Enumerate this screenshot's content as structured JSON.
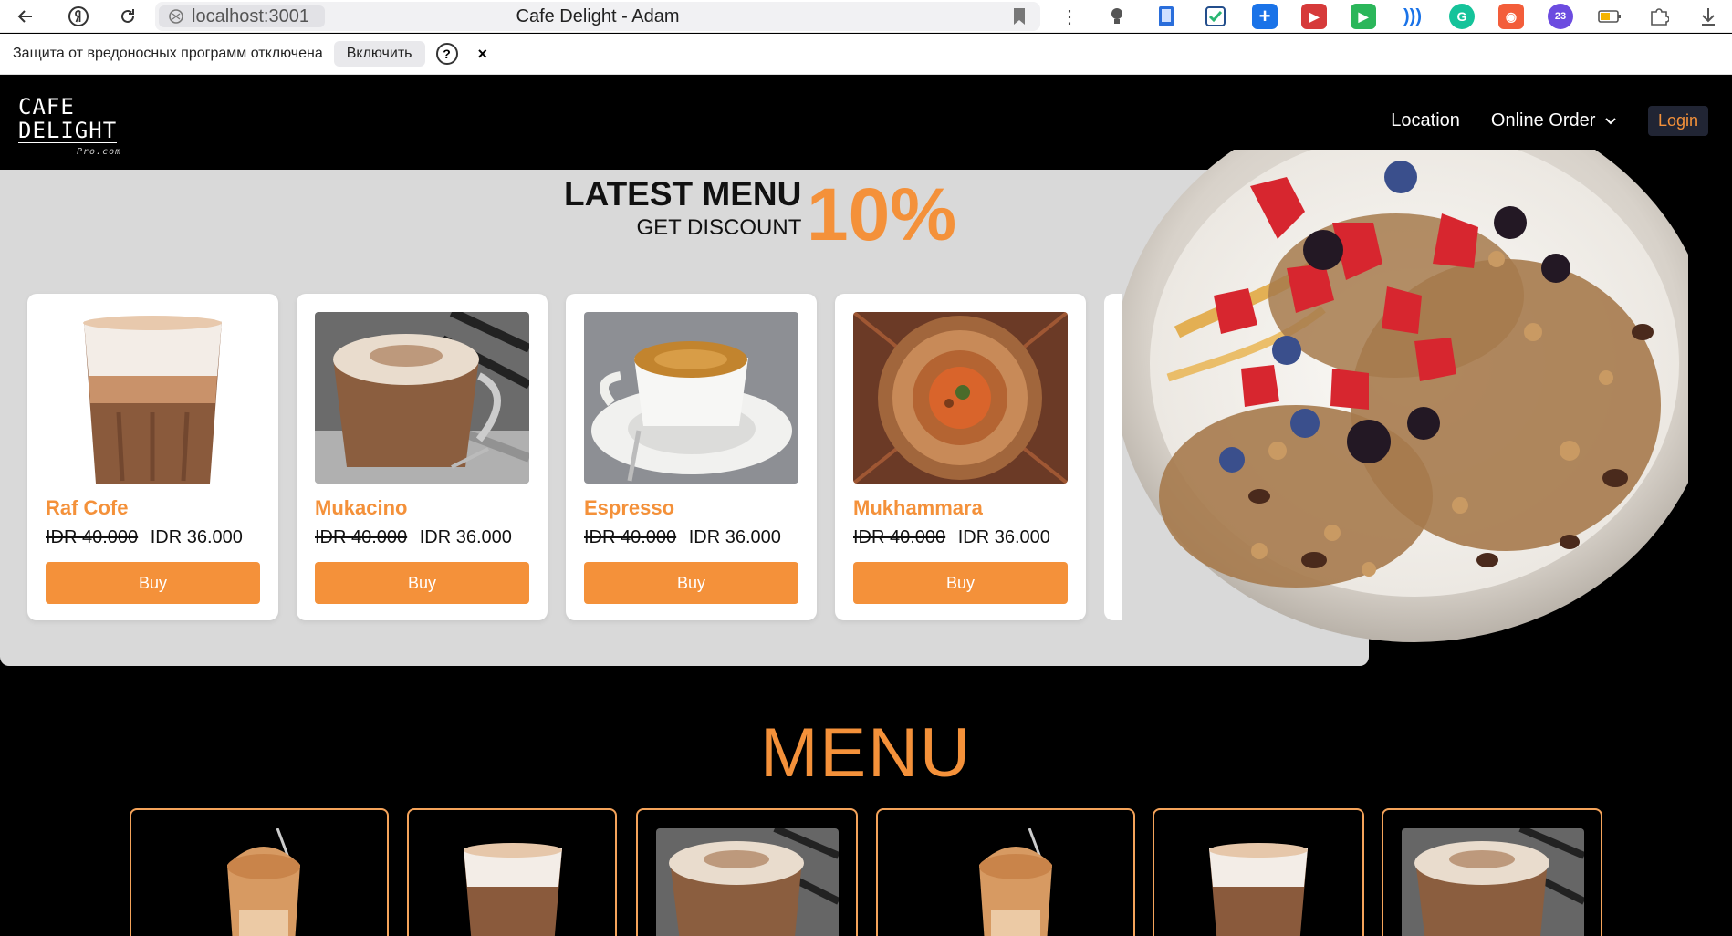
{
  "browser": {
    "url": "localhost:3001",
    "title": "Cafe Delight - Adam",
    "warning_text": "Защита от вредоносных программ отключена",
    "enable_label": "Включить",
    "help_label": "?",
    "close_label": "×"
  },
  "site": {
    "logo_line1": "CAFE",
    "logo_line2": "DELIGHT",
    "logo_signature": "Pro.com",
    "nav": {
      "location": "Location",
      "online_order": "Online Order",
      "login": "Login"
    }
  },
  "hero": {
    "heading": "LATEST MENU",
    "subheading": "GET DISCOUNT",
    "percent": "10%",
    "items": [
      {
        "name": "Raf Cofe",
        "old_price": "IDR 40.000",
        "new_price": "IDR 36.000",
        "button": "Buy"
      },
      {
        "name": "Mukacino",
        "old_price": "IDR 40.000",
        "new_price": "IDR 36.000",
        "button": "Buy"
      },
      {
        "name": "Espresso",
        "old_price": "IDR 40.000",
        "new_price": "IDR 36.000",
        "button": "Buy"
      },
      {
        "name": "Mukhammara",
        "old_price": "IDR 40.000",
        "new_price": "IDR 36.000",
        "button": "Buy"
      }
    ]
  },
  "menu": {
    "title": "MENU"
  },
  "colors": {
    "accent": "#f4913a",
    "hero_bg": "#d9d9d9",
    "header_bg": "#000000"
  }
}
